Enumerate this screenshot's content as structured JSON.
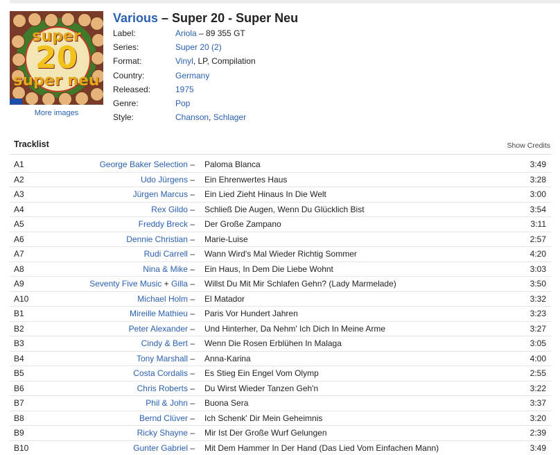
{
  "release": {
    "artist": "Various",
    "dash": " – ",
    "title": "Super 20 - Super Neu",
    "more_images": "More images",
    "cover_text": {
      "line1": "super",
      "line2": "20",
      "line3": "super neu"
    }
  },
  "info": {
    "label_key": "Label:",
    "label_link": "Ariola",
    "label_rest": " – 89 355 GT",
    "series_key": "Series:",
    "series_link": "Super 20 (2)",
    "format_key": "Format:",
    "format_link": "Vinyl",
    "format_rest": ", LP, Compilation",
    "country_key": "Country:",
    "country_link": "Germany",
    "released_key": "Released:",
    "released_link": "1975",
    "genre_key": "Genre:",
    "genre_link": "Pop",
    "style_key": "Style:",
    "style_link1": "Chanson",
    "style_sep": ", ",
    "style_link2": "Schlager"
  },
  "tracklist": {
    "heading": "Tracklist",
    "show_credits": "Show Credits",
    "tracks": [
      {
        "pos": "A1",
        "artist": "George Baker Selection",
        "title": "Paloma Blanca",
        "dur": "3:49"
      },
      {
        "pos": "A2",
        "artist": "Udo Jürgens",
        "title": "Ein Ehrenwertes Haus",
        "dur": "3:28"
      },
      {
        "pos": "A3",
        "artist": "Jürgen Marcus",
        "title": "Ein Lied Zieht Hinaus In Die Welt",
        "dur": "3:00"
      },
      {
        "pos": "A4",
        "artist": "Rex Gildo",
        "title": "Schließ Die Augen, Wenn Du Glücklich Bist",
        "dur": "3:54"
      },
      {
        "pos": "A5",
        "artist": "Freddy Breck",
        "title": "Der Große Zampano",
        "dur": "3:11"
      },
      {
        "pos": "A6",
        "artist": "Dennie Christian",
        "title": "Marie-Luise",
        "dur": "2:57"
      },
      {
        "pos": "A7",
        "artist": "Rudi Carrell",
        "title": "Wann Wird's Mal Wieder Richtig Sommer",
        "dur": "4:20"
      },
      {
        "pos": "A8",
        "artist": "Nina & Mike",
        "title": "Ein Haus, In Dem Die Liebe Wohnt",
        "dur": "3:03"
      },
      {
        "pos": "A9",
        "artist": "Seventy Five Music",
        "artist_join": " + ",
        "artist2": "Gilla",
        "title": "Willst Du Mit Mir Schlafen Gehn? (Lady Marmelade)",
        "dur": "3:50"
      },
      {
        "pos": "A10",
        "artist": "Michael Holm",
        "title": "El Matador",
        "dur": "3:32"
      },
      {
        "pos": "B1",
        "artist": "Mireille Mathieu",
        "title": "Paris Vor Hundert Jahren",
        "dur": "3:23"
      },
      {
        "pos": "B2",
        "artist": "Peter Alexander",
        "title": "Und Hinterher, Da Nehm' Ich Dich In Meine Arme",
        "dur": "3:27"
      },
      {
        "pos": "B3",
        "artist": "Cindy & Bert",
        "title": "Wenn Die Rosen Erblühen In Malaga",
        "dur": "3:05"
      },
      {
        "pos": "B4",
        "artist": "Tony Marshall",
        "title": "Anna-Karina",
        "dur": "4:00"
      },
      {
        "pos": "B5",
        "artist": "Costa Cordalis",
        "title": "Es Stieg Ein Engel Vom Olymp",
        "dur": "2:55"
      },
      {
        "pos": "B6",
        "artist": "Chris Roberts",
        "title": "Du Wirst Wieder Tanzen Geh'n",
        "dur": "3:22"
      },
      {
        "pos": "B7",
        "artist": "Phil & John",
        "title": "Buona Sera",
        "dur": "3:37"
      },
      {
        "pos": "B8",
        "artist": "Bernd Clüver",
        "title": "Ich Schenk' Dir Mein Geheimnis",
        "dur": "3:20"
      },
      {
        "pos": "B9",
        "artist": "Ricky Shayne",
        "title": "Mir Ist Der Große Wurf Gelungen",
        "dur": "2:39"
      },
      {
        "pos": "B10",
        "artist": "Gunter Gabriel",
        "title": "Mit Dem Hammer In Der Hand (Das Lied Vom Einfachen Mann)",
        "dur": "3:49"
      }
    ],
    "dash": " – "
  }
}
